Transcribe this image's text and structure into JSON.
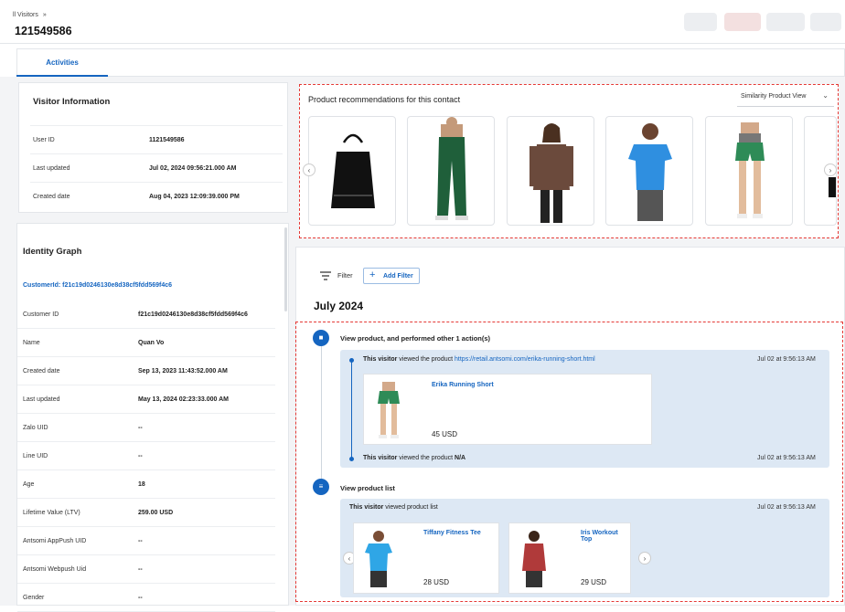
{
  "header": {
    "breadcrumb": "ll Visitors",
    "breadcrumb_sep": "»",
    "title": "121549586"
  },
  "tabs": [
    {
      "label": "Activities",
      "active": true
    }
  ],
  "visitor_info": {
    "title": "Visitor Information",
    "rows": [
      {
        "label": "User ID",
        "value": "1121549586"
      },
      {
        "label": "Last updated",
        "value": "Jul 02, 2024 09:56:21.000 AM"
      },
      {
        "label": "Created date",
        "value": "Aug 04, 2023 12:09:39.000 PM"
      }
    ]
  },
  "identity_graph": {
    "title": "Identity Graph",
    "customer_link": "CustomerId: f21c19d0246130e8d38cf5fdd569f4c6",
    "rows": [
      {
        "label": "Customer ID",
        "value": "f21c19d0246130e8d38cf5fdd569f4c6"
      },
      {
        "label": "Name",
        "value": "Quan Vo"
      },
      {
        "label": "Created date",
        "value": "Sep 13, 2023 11:43:52.000 AM"
      },
      {
        "label": "Last updated",
        "value": "May 13, 2024 02:23:33.000 AM"
      },
      {
        "label": "Zalo UID",
        "value": "--"
      },
      {
        "label": "Line UID",
        "value": "--"
      },
      {
        "label": "Age",
        "value": "18"
      },
      {
        "label": "Lifetime Value (LTV)",
        "value": "259.00 USD"
      },
      {
        "label": "Antsomi AppPush UID",
        "value": "--"
      },
      {
        "label": "Antsomi Webpush Uid",
        "value": "--"
      },
      {
        "label": "Gender",
        "value": "--"
      }
    ]
  },
  "recommendations": {
    "title": "Product recommendations for this contact",
    "dropdown_value": "Similarity Product View",
    "prev_icon": "chevron-left-icon",
    "next_icon": "chevron-right-icon",
    "products": [
      {
        "icon": "black-tote-bag-image",
        "color": "#111111"
      },
      {
        "icon": "green-pants-image",
        "color": "#1f5f3a"
      },
      {
        "icon": "brown-jacket-image",
        "color": "#6b4a3c"
      },
      {
        "icon": "blue-tee-image",
        "color": "#2f8fe0"
      },
      {
        "icon": "green-shorts-image",
        "color": "#2e8b57"
      }
    ]
  },
  "activity": {
    "filter_label": "Filter",
    "add_filter_label": "Add Filter",
    "month": "July 2024",
    "groups": [
      {
        "title": "View product, and performed other 1 action(s)",
        "events": [
          {
            "actor": "This visitor",
            "action": "viewed the product",
            "target": "https://retail.antsomi.com/erika-running-short.html",
            "time": "Jul 02 at 9:56:13 AM"
          },
          {
            "actor": "This visitor",
            "action": "viewed the product",
            "target": "N/A",
            "time": "Jul 02 at 9:56:13 AM"
          }
        ],
        "product": {
          "name": "Erika Running Short",
          "price": "45 USD"
        }
      },
      {
        "title": "View product list",
        "events": [
          {
            "actor": "This visitor",
            "action": "viewed product list",
            "time": "Jul 02 at 9:56:13 AM"
          }
        ],
        "products": [
          {
            "name": "Tiffany Fitness Tee",
            "price": "28 USD"
          },
          {
            "name": "Iris Workout Top",
            "price": "29 USD"
          }
        ]
      }
    ]
  }
}
